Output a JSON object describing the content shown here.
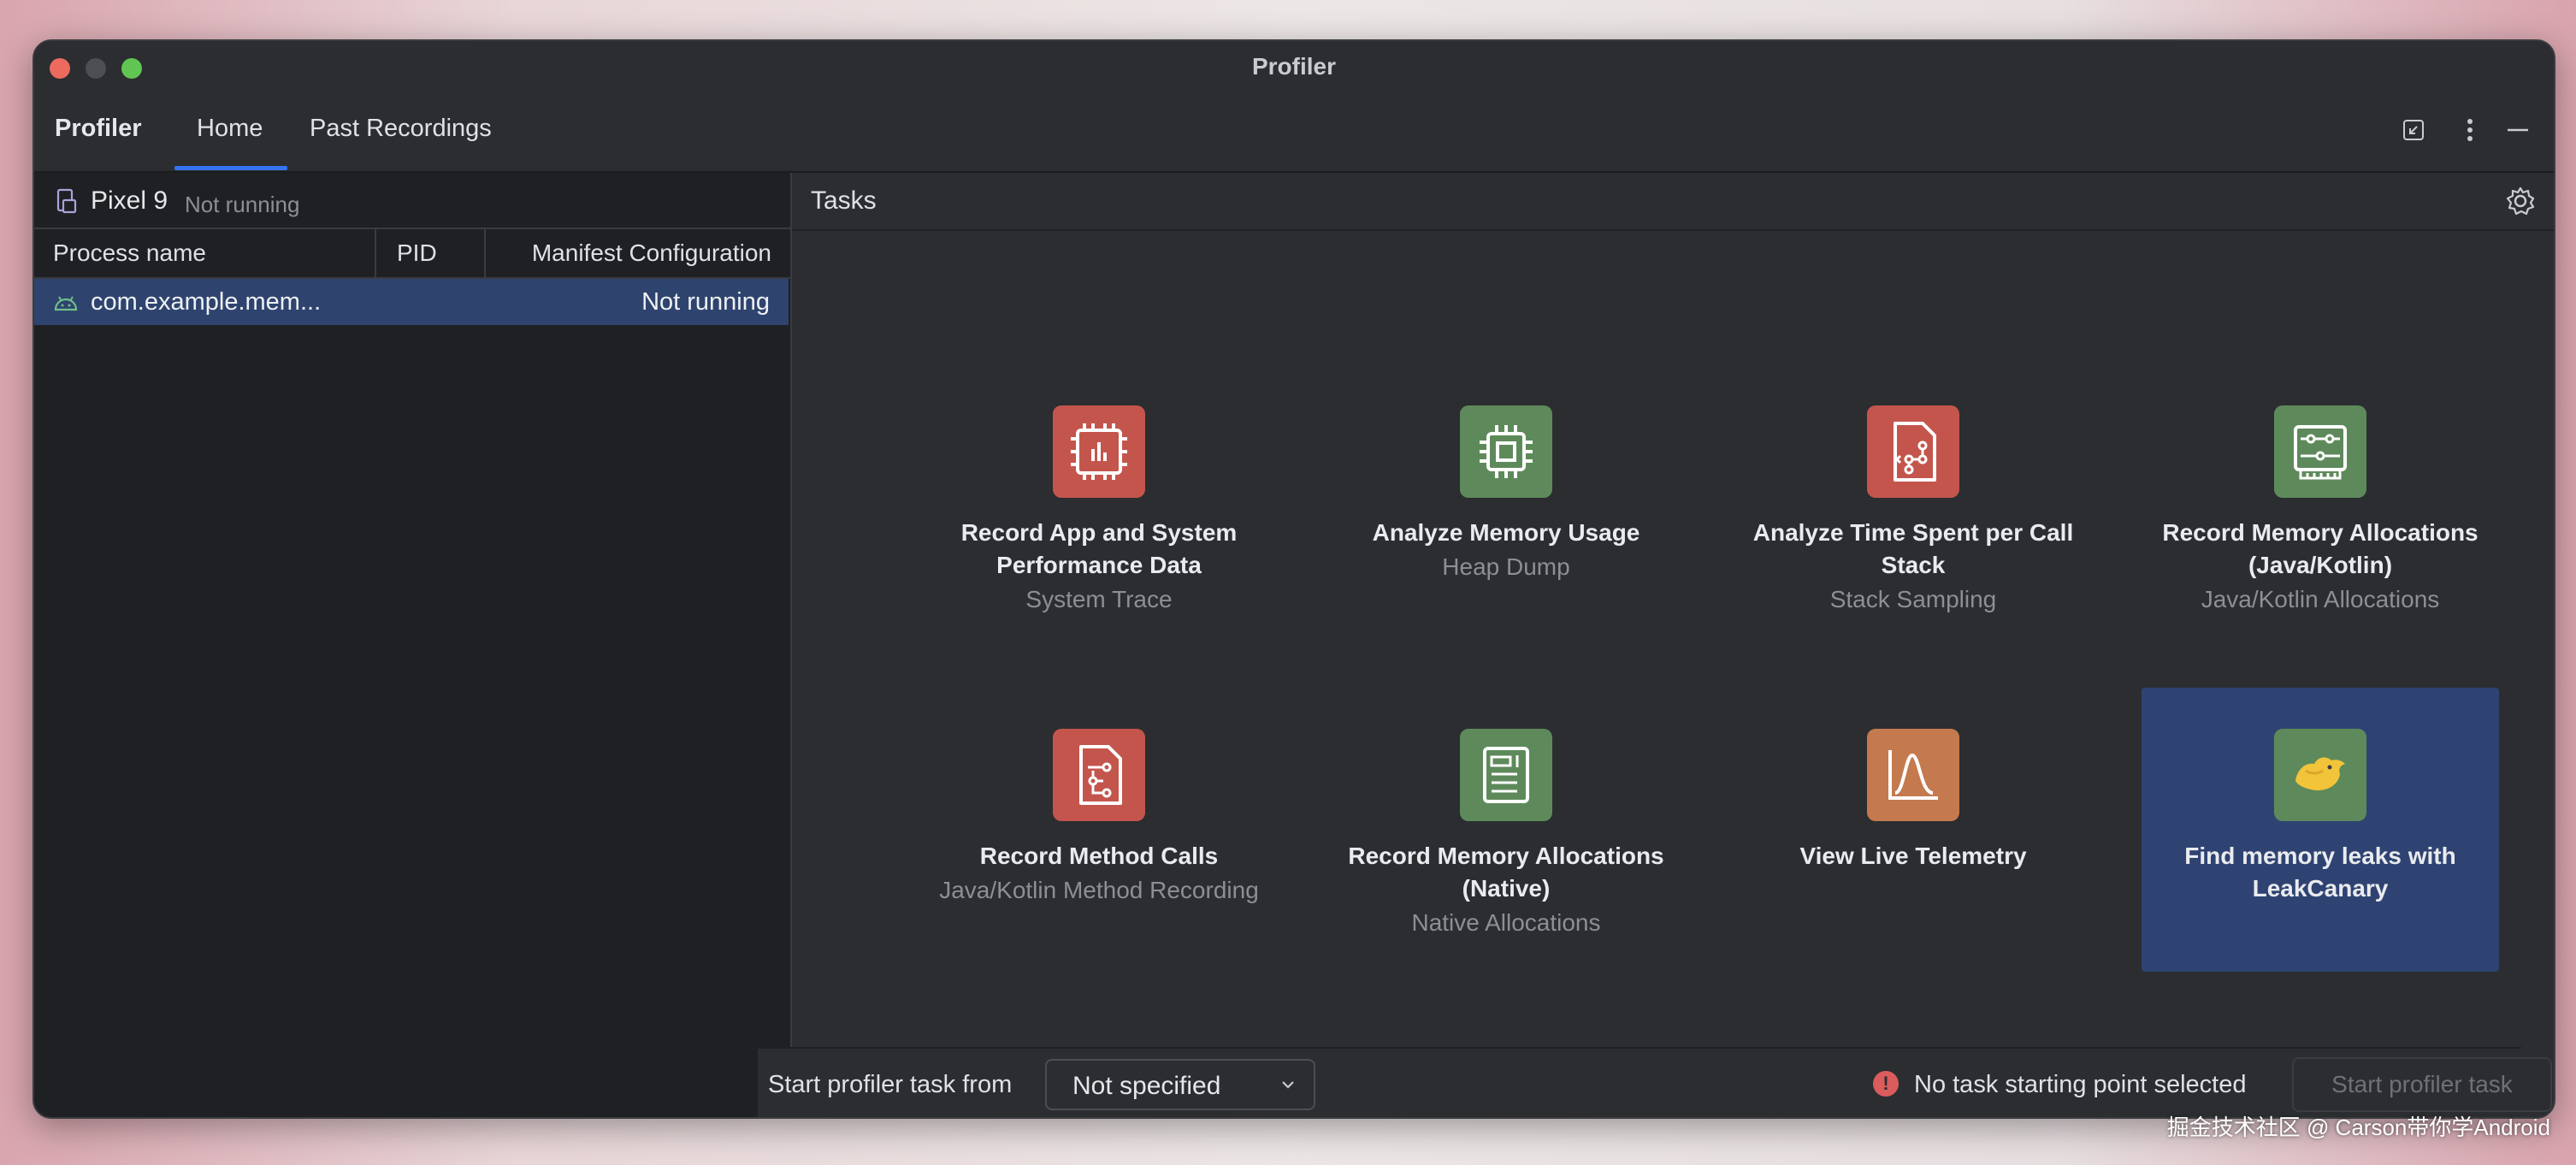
{
  "window": {
    "title": "Profiler"
  },
  "tabbar": {
    "tool_name": "Profiler",
    "tabs": [
      {
        "label": "Home",
        "selected": true
      },
      {
        "label": "Past Recordings",
        "selected": false
      }
    ]
  },
  "device": {
    "name": "Pixel 9",
    "status": "Not running"
  },
  "process_table": {
    "columns": [
      "Process name",
      "PID",
      "Manifest Configuration"
    ],
    "rows": [
      {
        "name": "com.example.mem...",
        "pid": "",
        "status": "Not running"
      }
    ]
  },
  "tasks": {
    "label": "Tasks",
    "cards": [
      {
        "title": "Record App and System Performance Data",
        "subtitle": "System Trace",
        "icon": "system-trace-icon",
        "color": "#c4554d"
      },
      {
        "title": "Analyze Memory Usage",
        "subtitle": "Heap Dump",
        "icon": "heap-dump-icon",
        "color": "#5e8a5b"
      },
      {
        "title": "Analyze Time Spent per Call Stack",
        "subtitle": "Stack Sampling",
        "icon": "stack-sampling-icon",
        "color": "#c4554d"
      },
      {
        "title": "Record Memory Allocations (Java/Kotlin)",
        "subtitle": "Java/Kotlin Allocations",
        "icon": "java-allocations-icon",
        "color": "#5e8a5b"
      },
      {
        "title": "Record Method Calls",
        "subtitle": "Java/Kotlin Method Recording",
        "icon": "method-recording-icon",
        "color": "#c4554d"
      },
      {
        "title": "Record Memory Allocations (Native)",
        "subtitle": "Native Allocations",
        "icon": "native-allocations-icon",
        "color": "#5e8a5b"
      },
      {
        "title": "View Live Telemetry",
        "subtitle": "",
        "icon": "live-telemetry-icon",
        "color": "#c47a4e"
      },
      {
        "title": "Find memory leaks with LeakCanary",
        "subtitle": "",
        "icon": "leakcanary-icon",
        "color": "#5e8a5b",
        "selected": true
      }
    ]
  },
  "footer": {
    "start_label": "Start profiler task from",
    "start_select": "Not specified",
    "warning": "No task starting point selected",
    "start_button": "Start profiler task"
  },
  "watermark": "掘金技术社区 @ Carson带你学Android",
  "colors": {
    "accent": "#3574f0",
    "selection": "#2e436e",
    "card_selected": "#2f4373",
    "warning": "#db5c5c"
  }
}
